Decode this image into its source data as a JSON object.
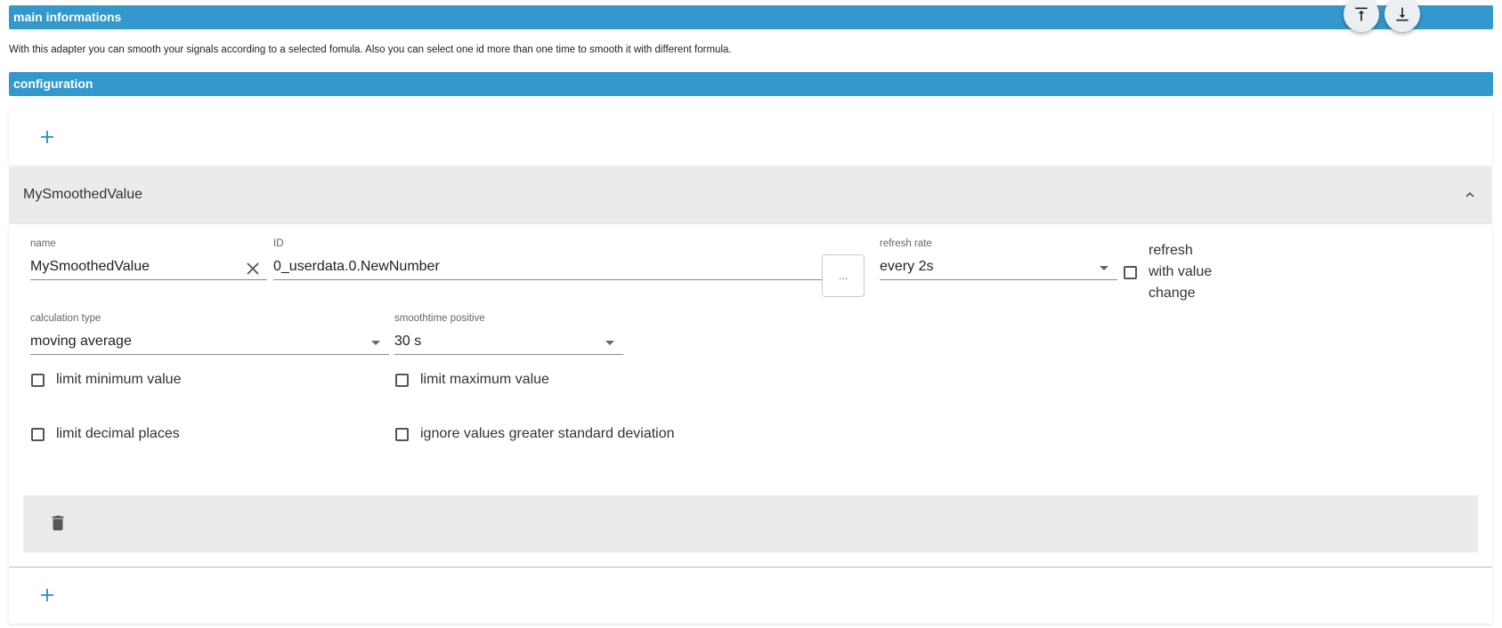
{
  "sections": {
    "main_title": "main informations",
    "description": "With this adapter you can smooth your signals according to a selected fomula. Also you can select one id more than one time to smooth it with different formula.",
    "config_title": "configuration"
  },
  "item": {
    "title": "MySmoothedValue",
    "name_label": "name",
    "name_value": "MySmoothedValue",
    "id_label": "ID",
    "id_value": "0_userdata.0.NewNumber",
    "id_button": "...",
    "refresh_rate_label": "refresh rate",
    "refresh_rate_value": "every 2s",
    "refresh_with_change_label": "refresh with value change",
    "calc_type_label": "calculation type",
    "calc_type_value": "moving average",
    "smoothtime_label": "smoothtime positive",
    "smoothtime_value": "30 s",
    "limit_min_label": "limit minimum value",
    "limit_max_label": "limit maximum value",
    "limit_decimal_label": "limit decimal places",
    "ignore_std_label": "ignore values greater standard deviation"
  },
  "colors": {
    "header_bar": "#3399cc",
    "accent": "#2a8fc7",
    "accordion_bg": "#ebebeb"
  },
  "icons": {
    "add": "plus-icon",
    "collapse": "chevron-up-icon",
    "clear": "close-icon",
    "delete": "trash-icon",
    "scroll_top": "vertical-align-top-icon",
    "scroll_bottom": "vertical-align-bottom-icon"
  }
}
